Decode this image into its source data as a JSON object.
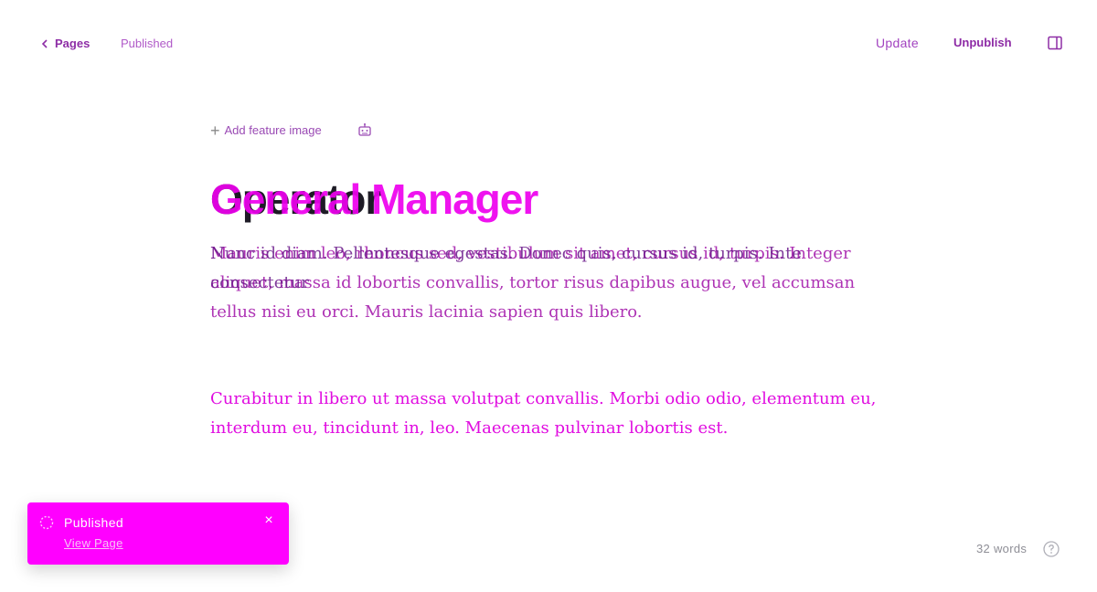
{
  "header": {
    "back_label": "Pages",
    "status_text": "Published",
    "update_label": "Update",
    "unpublish_label": "Unpublish",
    "sidebar_toggle_icon": "sidebar-panel-icon"
  },
  "feature": {
    "add_label": "Add feature image",
    "ai_icon": "robot-icon"
  },
  "post": {
    "title_old": "Operator",
    "title_new": "General Manager",
    "para1_old": "Mauris enim leo, rhoncus sed, vestibulum sit amet, cursus id, turpis. Integer aliquet, massa id lobortis convallis, tortor risus dapibus augue, vel accumsan tellus nisi eu orci. Mauris lacinia sapien quis libero.",
    "para1_new": "Nunc id diam. Pellentesque egestas. Donec quis, cursus id, turpis. Inte consectetur",
    "para2": "Curabitur in libero ut massa volutpat convallis. Morbi odio odio, elementum eu, interdum eu, tincidunt in, leo. Maecenas pulvinar lobortis est."
  },
  "toast": {
    "title": "Published",
    "link_label": "View Page",
    "close_icon": "close-icon",
    "status_icon": "spinner-icon",
    "background": "#ff00ff"
  },
  "footer": {
    "word_count": "32 words",
    "help_icon": "help-icon"
  },
  "colors": {
    "accent": "#ff00ff",
    "title_dark": "#1e1b26",
    "text_purple": "#8e2ea6"
  }
}
